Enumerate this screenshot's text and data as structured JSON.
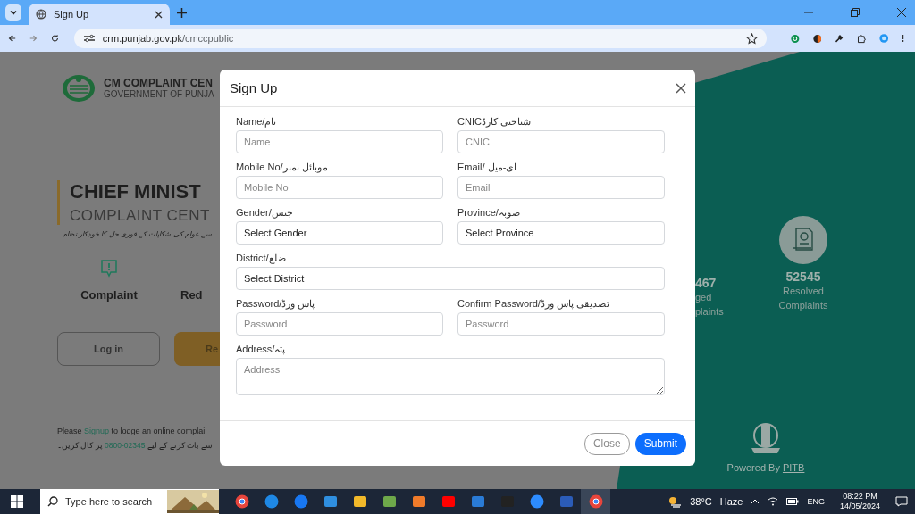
{
  "browser": {
    "tab": {
      "title": "Sign Up",
      "selected": true
    },
    "url": {
      "host": "crm.punjab.gov.pk",
      "path": "/cmccpublic"
    }
  },
  "page": {
    "header": {
      "title": "CM COMPLAINT CEN",
      "subtitle": "GOVERNMENT OF PUNJA"
    },
    "hero": {
      "title": "CHIEF MINIST",
      "subtitle": "COMPLAINT CENT",
      "tagline": "سے عوام کی شکایات کے فوری حل کا خودکار نظام"
    },
    "features": [
      {
        "label": "Complaint",
        "kind": "icon"
      },
      {
        "label": "Red",
        "kind": "text"
      }
    ],
    "buttons": [
      {
        "label": "Log in",
        "kind": "outline"
      },
      {
        "label": "Re",
        "kind": "filled"
      }
    ],
    "footer": {
      "line_1": {
        "before": "Please",
        "link": "Signup",
        "after": "to lodge an online complai"
      },
      "line_2": {
        "before": "سے بات کرنے کے لیے",
        "number": "0800-02345",
        "after": "پر کال کریں۔"
      }
    },
    "stats": [
      {
        "number": "467",
        "lines": [
          "ged",
          "plaints"
        ]
      },
      {
        "number": "52545",
        "lines": [
          "Resolved",
          "Complaints"
        ]
      }
    ],
    "powered": {
      "text": "Powered By",
      "link": "PITB"
    }
  },
  "modal": {
    "title": "Sign Up",
    "fields": [
      {
        "label": "Name/نام",
        "kind": "input",
        "placeholder": "Name"
      },
      {
        "label": "CNICشناختی کارڈ",
        "kind": "input",
        "placeholder": "CNIC"
      },
      {
        "label": "Mobile No/موبائل نمبر",
        "kind": "input",
        "placeholder": "Mobile No"
      },
      {
        "label": "Email/ ای-میل",
        "kind": "input",
        "placeholder": "Email"
      },
      {
        "label": "Gender/جنس",
        "kind": "select",
        "value": "Select Gender"
      },
      {
        "label": "Province/صوبہ",
        "kind": "select",
        "value": "Select Province"
      },
      {
        "label": "District/ضلع",
        "kind": "select",
        "value": "Select District",
        "full_width": true
      },
      {
        "label": "Password/پاس ورڈ",
        "kind": "input",
        "placeholder": "Password"
      },
      {
        "label": "Confirm Password/تصدیقی پاس ورڈ",
        "kind": "input",
        "placeholder": "Password"
      },
      {
        "label": "Address/پتہ",
        "kind": "textarea",
        "placeholder": "Address",
        "full_width": true
      }
    ],
    "buttons": [
      {
        "label": "Close",
        "kind": "secondary"
      },
      {
        "label": "Submit",
        "kind": "primary"
      }
    ]
  },
  "taskbar": {
    "search": {
      "placeholder": "Type here to search"
    },
    "apps": [
      {
        "kind": "browser",
        "active": false
      },
      {
        "kind": "edge",
        "active": false
      },
      {
        "kind": "social",
        "active": false
      },
      {
        "kind": "code",
        "active": false
      },
      {
        "kind": "folder",
        "active": false
      },
      {
        "kind": "notepad",
        "active": false
      },
      {
        "kind": "package",
        "active": false
      },
      {
        "kind": "video",
        "active": false
      },
      {
        "kind": "mail",
        "active": false
      },
      {
        "kind": "terminal",
        "active": false
      },
      {
        "kind": "call",
        "active": false
      },
      {
        "kind": "document",
        "active": false
      },
      {
        "kind": "browser",
        "active": true
      }
    ],
    "weather": {
      "temp": "38°C",
      "condition": "Haze"
    },
    "language": "ENG",
    "time": "08:22 PM",
    "date": "14/05/2024"
  }
}
